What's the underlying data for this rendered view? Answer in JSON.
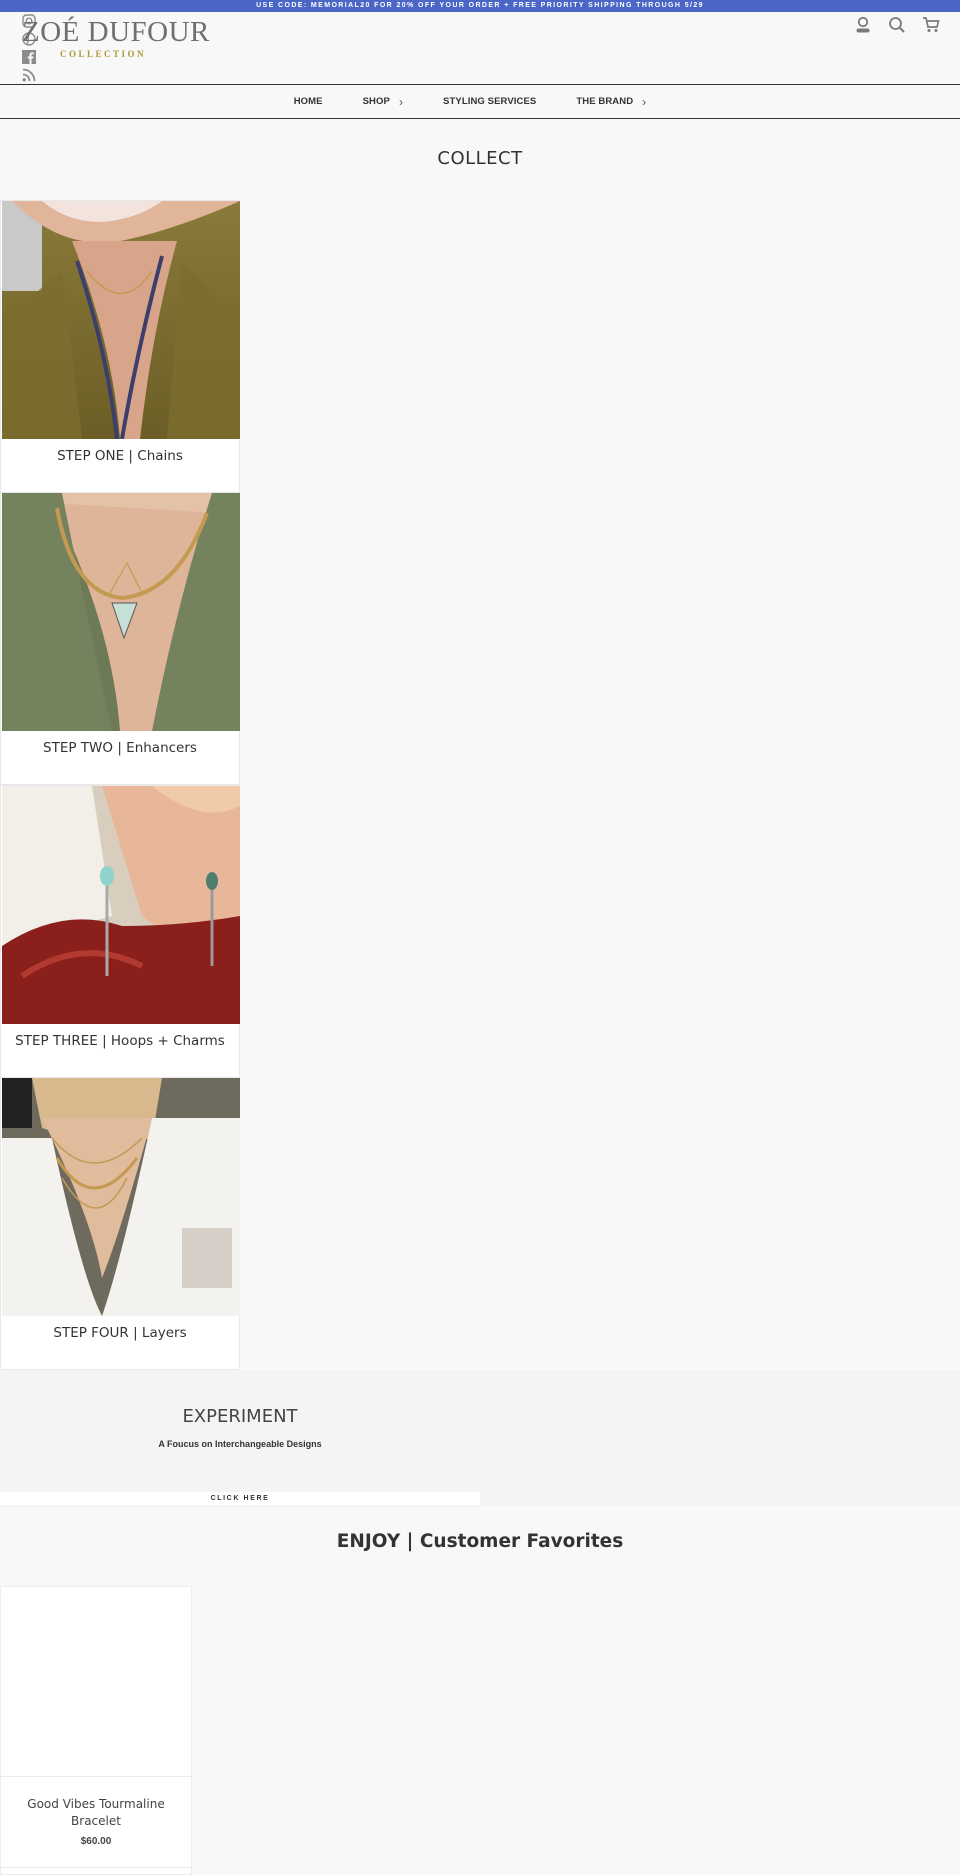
{
  "announcement": "USE CODE: MEMORIAL20 FOR 20% OFF YOUR ORDER + FREE PRIORITY SHIPPING THROUGH 5/29",
  "brand": {
    "name": "ZOÉ DUFOUR",
    "sub": "COLLECTION",
    "accent": "#b09a36"
  },
  "social_icons": [
    "instagram-icon",
    "pinterest-icon",
    "facebook-icon",
    "rss-icon"
  ],
  "header_icons": [
    "account-icon",
    "search-icon",
    "cart-icon"
  ],
  "nav": {
    "home": "HOME",
    "shop": "SHOP",
    "styling": "STYLING SERVICES",
    "brand": "THE BRAND"
  },
  "collect": {
    "title": "COLLECT",
    "cards": [
      {
        "label": "STEP ONE  |  Chains"
      },
      {
        "label": "STEP TWO |  Enhancers"
      },
      {
        "label": "STEP THREE  | Hoops + Charms"
      },
      {
        "label": "STEP FOUR  |  Layers"
      }
    ]
  },
  "experiment": {
    "title": "EXPERIMENT",
    "subtitle": "A Foucus on Interchangeable Designs",
    "button": "CLICK HERE"
  },
  "enjoy": {
    "title": "ENJOY | Customer Favorites",
    "products": [
      {
        "name": "Good Vibes Tourmaline Bracelet",
        "price": "$60.00"
      }
    ]
  },
  "colors": {
    "announcement_bg": "#4a66c6",
    "page_bg": "#f8f8f8"
  }
}
